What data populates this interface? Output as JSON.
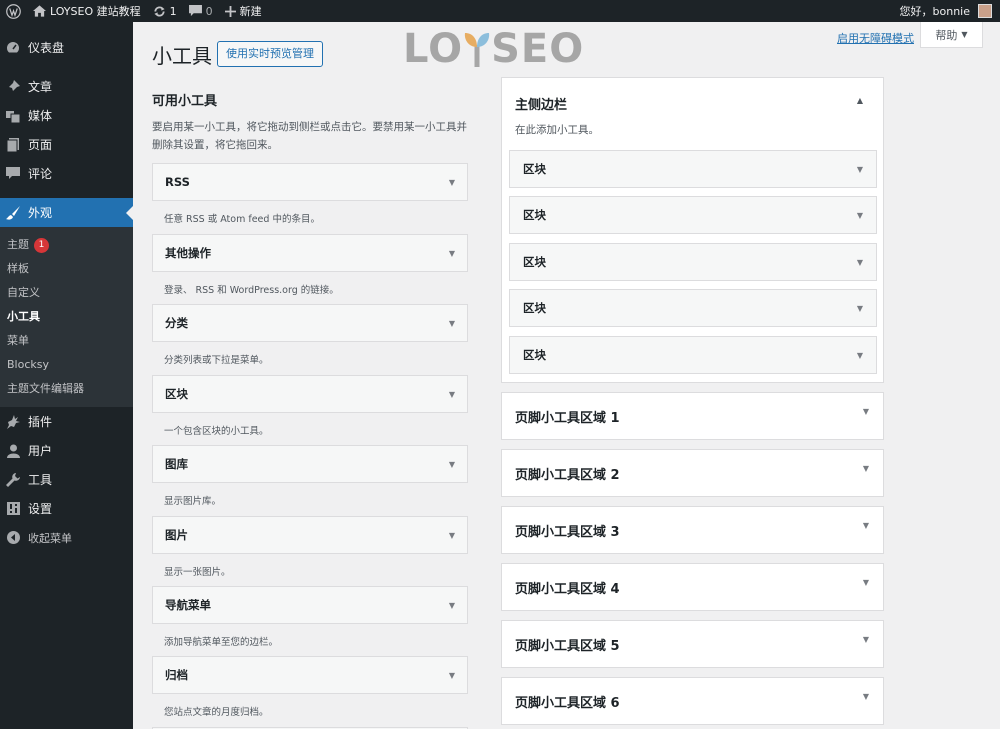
{
  "adminbar": {
    "site_name": "LOYSEO 建站教程",
    "updates_count": "1",
    "comments_count": "0",
    "new_label": "新建",
    "greeting": "您好，bonnie"
  },
  "menu": {
    "dashboard": "仪表盘",
    "posts": "文章",
    "media": "媒体",
    "pages": "页面",
    "comments": "评论",
    "appearance": "外观",
    "sub": {
      "themes": "主题",
      "themes_badge": "1",
      "patterns": "样板",
      "customize": "自定义",
      "widgets": "小工具",
      "menus": "菜单",
      "blocksy": "Blocksy",
      "theme_editor": "主题文件编辑器"
    },
    "plugins": "插件",
    "users": "用户",
    "tools": "工具",
    "settings": "设置",
    "collapse": "收起菜单"
  },
  "header": {
    "title": "小工具",
    "preview_button": "使用实时预览管理",
    "a11y_link": "启用无障碍模式",
    "help": "帮助",
    "logo_text_left": "LO",
    "logo_text_right": "SEO"
  },
  "available": {
    "title": "可用小工具",
    "description": "要启用某一小工具，将它拖动到侧栏或点击它。要禁用某一小工具并删除其设置，将它拖回来。",
    "widgets": [
      {
        "name": "RSS",
        "desc": "任意 RSS 或 Atom feed 中的条目。"
      },
      {
        "name": "其他操作",
        "desc": "登录、 RSS 和 WordPress.org 的链接。"
      },
      {
        "name": "分类",
        "desc": "分类列表或下拉是菜单。"
      },
      {
        "name": "区块",
        "desc": "一个包含区块的小工具。"
      },
      {
        "name": "图库",
        "desc": "显示图片库。"
      },
      {
        "name": "图片",
        "desc": "显示一张图片。"
      },
      {
        "name": "导航菜单",
        "desc": "添加导航菜单至您的边栏。"
      },
      {
        "name": "归档",
        "desc": "您站点文章的月度归档。"
      }
    ]
  },
  "main_sidebar": {
    "title": "主侧边栏",
    "description": "在此添加小工具。",
    "blocks": [
      "区块",
      "区块",
      "区块",
      "区块",
      "区块"
    ]
  },
  "footer_areas": [
    "页脚小工具区域 1",
    "页脚小工具区域 2",
    "页脚小工具区域 3",
    "页脚小工具区域 4",
    "页脚小工具区域 5",
    "页脚小工具区域 6"
  ],
  "colors": {
    "accent": "#2271b1",
    "adminbar": "#1d2327",
    "badge": "#d63638"
  }
}
